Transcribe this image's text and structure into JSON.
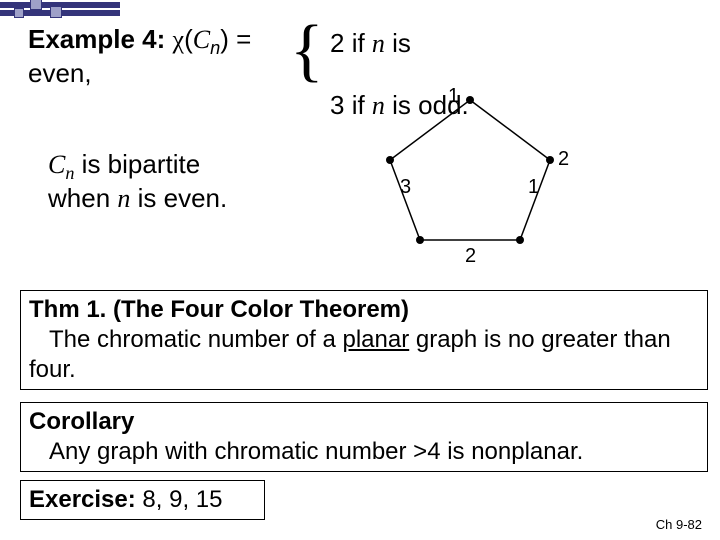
{
  "header": {
    "example_label": "Example 4:",
    "chi": "χ",
    "open": "(",
    "C": "C",
    "n": "n",
    "close_eq": ") =",
    "brace": "{",
    "case_even_num": "2",
    "case_even_txt": " if ",
    "case_even_var": "n",
    "case_even_tail": " is",
    "even_word": "even,",
    "case_odd_num": "3",
    "case_odd_txt": " if ",
    "case_odd_var": "n",
    "case_odd_tail": " is odd."
  },
  "bipartite": {
    "C": "C",
    "n": "n",
    "line1_tail": " is bipartite",
    "line2_pre": "when ",
    "line2_var": "n",
    "line2_tail": " is even."
  },
  "pentagon": {
    "labels": [
      "1",
      "2",
      "3",
      "1",
      "2"
    ]
  },
  "thm": {
    "title": "Thm 1. (The Four Color Theorem)",
    "body_pre": "The chromatic number of a ",
    "planar": "planar",
    "body_post": " graph is no greater than four."
  },
  "corollary": {
    "title": "Corollary",
    "body": "Any graph with chromatic number >4 is nonplanar."
  },
  "exercise": {
    "title": "Exercise:",
    "items": " 8, 9, 15"
  },
  "footer": "Ch 9-82"
}
